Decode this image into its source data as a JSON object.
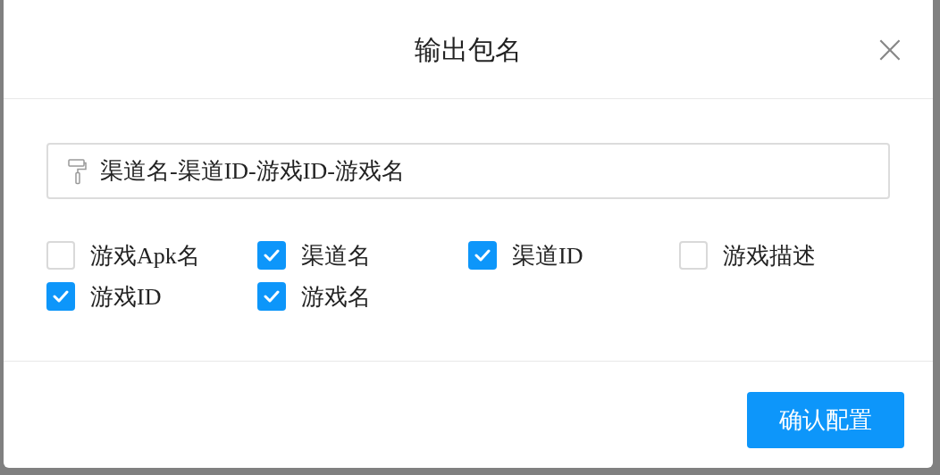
{
  "dialog": {
    "title": "输出包名",
    "close": "×"
  },
  "format_field": {
    "value": "渠道名-渠道ID-游戏ID-游戏名"
  },
  "options": [
    {
      "label": "游戏Apk名",
      "checked": false
    },
    {
      "label": "渠道名",
      "checked": true
    },
    {
      "label": "渠道ID",
      "checked": true
    },
    {
      "label": "游戏描述",
      "checked": false
    },
    {
      "label": "游戏ID",
      "checked": true
    },
    {
      "label": "游戏名",
      "checked": true
    }
  ],
  "confirm_button": "确认配置"
}
